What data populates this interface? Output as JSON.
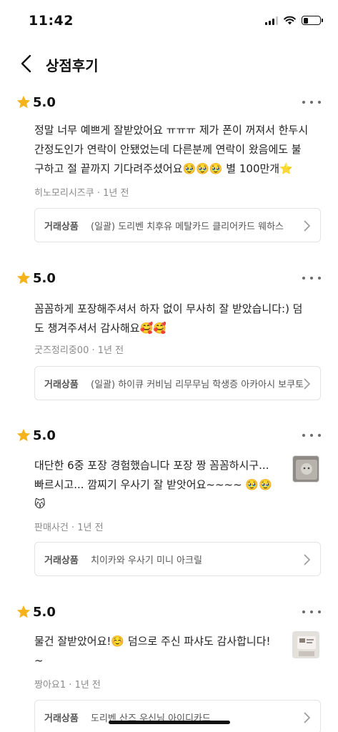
{
  "status_bar": {
    "time": "11:42",
    "battery_level": 0.3
  },
  "header": {
    "title": "상점후기"
  },
  "reviews": [
    {
      "rating": "5.0",
      "text": "정말 너무 예쁘게 잘받았어요 ㅠㅠㅠ 제가 폰이 꺼져서 한두시\n간정도인가 연락이 안됐었는데 다른분께 연락이 왔음에도 불\n구하고 절 끝까지 기다려주셨어요🥹🥹🥹 별 100만개⭐",
      "reviewer": "히노모리시즈쿠",
      "time": "1년 전",
      "product_label": "거래상품",
      "product_name": "(일괄) 도리벤 치후유 메탈카드 클리어카드 웨하스",
      "has_photo": false
    },
    {
      "rating": "5.0",
      "text": "꼼꼼하게 포장해주셔서 하자 없이 무사히 잘 받았습니다:) 덤\n도 챙겨주셔서 감사해요🥰🥰",
      "reviewer": "굿즈정리중00",
      "time": "1년 전",
      "product_label": "거래상품",
      "product_name": "(일괄) 하이큐 커비님 리무무님 학생증 아카아시 보쿠토",
      "has_photo": false
    },
    {
      "rating": "5.0",
      "text": "대단한 6중 포장 경험했습니다 포장 짱 꼼꼼하시구...\n빠르시고... 깜찌기 우사기 잘 받앗어요~~~~ 🥹🥹\n😽",
      "reviewer": "판매사건",
      "time": "1년 전",
      "product_label": "거래상품",
      "product_name": "치이카와 우사기 미니 아크릴",
      "has_photo": true
    },
    {
      "rating": "5.0",
      "text": "물건 잘받았어요!☺️ 덤으로 주신 파샤도 감사합니다!\n~",
      "reviewer": "짱아요1",
      "time": "1년 전",
      "product_label": "거래상품",
      "product_name": "도리벤 산즈 우신님 아이디카드",
      "has_photo": true
    }
  ],
  "icons": {
    "back": "chevron-left-icon",
    "star": "star-icon",
    "more": "more-horizontal-icon",
    "chevron": "chevron-right-icon"
  },
  "colors": {
    "star": "#f5b31a",
    "text": "#222222",
    "meta": "#8a8a8a",
    "border": "#e3e3e3"
  }
}
